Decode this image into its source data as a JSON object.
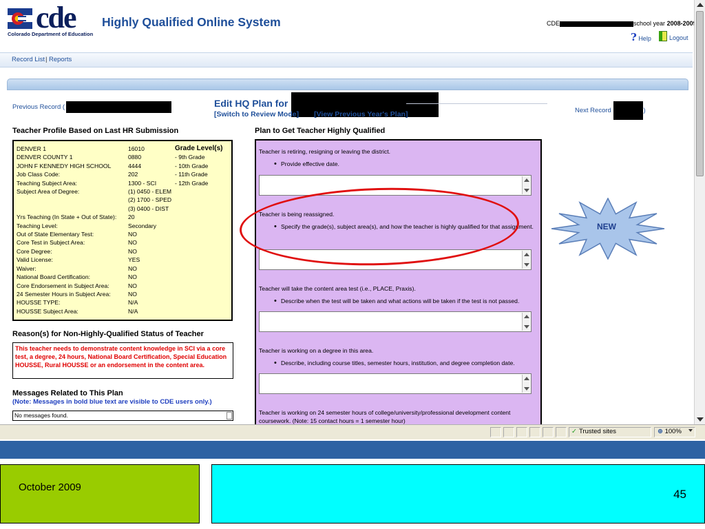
{
  "header": {
    "logo_text": "cde",
    "logo_subtitle": "Colorado Department of Education",
    "app_title": "Highly Qualified Online System",
    "school_year_prefix": "CDE",
    "school_year_suffix": "school year",
    "school_year_value": "2008-2009.",
    "help_label": "Help",
    "logout_label": "Logout"
  },
  "nav": {
    "record_list": "Record List",
    "separator": "|",
    "reports": "Reports"
  },
  "record_bar": {
    "previous_record": "Previous Record (",
    "edit_title": "Edit HQ Plan for",
    "switch_mode": "[Switch to Review Mode]",
    "view_previous": "[View Previous Year's Plan]",
    "next_record": "Next Record",
    "next_record_close": ")"
  },
  "profile": {
    "heading": "Teacher Profile Based on Last HR Submission",
    "grade_heading": "Grade Level(s)",
    "rows": [
      {
        "label": "DENVER 1",
        "value": "16010",
        "grade": ""
      },
      {
        "label": "DENVER COUNTY 1",
        "value": "0880",
        "grade": "- 9th Grade"
      },
      {
        "label": "JOHN F KENNEDY HIGH SCHOOL",
        "value": "4444",
        "grade": "- 10th Grade"
      },
      {
        "label": "Job Class Code:",
        "value": "202",
        "grade": "- 11th Grade"
      },
      {
        "label": "Teaching Subject Area:",
        "value": "1300 - SCI",
        "grade": "- 12th Grade"
      },
      {
        "label": "Subject Area of Degree:",
        "value": "(1) 0450 - ELEM",
        "grade": ""
      },
      {
        "label": "",
        "value": "(2) 1700 - SPED",
        "grade": ""
      },
      {
        "label": "",
        "value": "(3) 0400 - DIST",
        "grade": ""
      },
      {
        "label": "Yrs Teaching (In State + Out of State):",
        "value": "20",
        "grade": ""
      },
      {
        "label": "Teaching Level:",
        "value": "Secondary",
        "grade": ""
      },
      {
        "label": "Out of State Elementary Test:",
        "value": "NO",
        "grade": ""
      },
      {
        "label": "Core Test in Subject Area:",
        "value": "NO",
        "grade": ""
      },
      {
        "label": "Core Degree:",
        "value": "NO",
        "grade": ""
      },
      {
        "label": "Valid License:",
        "value": "YES",
        "grade": ""
      },
      {
        "label": "Waiver:",
        "value": "NO",
        "grade": ""
      },
      {
        "label": "National Board Certification:",
        "value": "NO",
        "grade": ""
      },
      {
        "label": "Core Endorsement in Subject Area:",
        "value": "NO",
        "grade": ""
      },
      {
        "label": "24 Semester Hours in Subject Area:",
        "value": "NO",
        "grade": ""
      },
      {
        "label": "HOUSSE TYPE:",
        "value": "N/A",
        "grade": ""
      },
      {
        "label": "HOUSSE Subject Area:",
        "value": "N/A",
        "grade": ""
      }
    ]
  },
  "reasons": {
    "heading": "Reason(s) for Non-Highly-Qualified Status of Teacher",
    "text": "This teacher needs to demonstrate content knowledge in SCI via a core test, a degree, 24 hours, National Board Certification, Special Education HOUSSE, Rural HOUSSE or an endorsement in the content area."
  },
  "messages": {
    "heading": "Messages Related to This Plan",
    "note": "(Note: Messages in bold blue text are visible to CDE users only.)",
    "empty_text": "No messages found."
  },
  "plan": {
    "heading": "Plan to Get Teacher Highly Qualified",
    "sections": [
      {
        "intro": "Teacher is retiring, resigning or leaving the district.",
        "bullet": "Provide effective date."
      },
      {
        "intro": "Teacher is being reassigned.",
        "bullet": "Specify the grade(s), subject area(s), and how the teacher is highly qualified for that assignment."
      },
      {
        "intro": "Teacher will take the content area test (i.e., PLACE, Praxis).",
        "bullet": "Describe when the test will be taken and what actions will be taken if the test is not passed."
      },
      {
        "intro": "Teacher is working on a degree in this area.",
        "bullet": "Describe, including course titles, semester hours, institution, and degree completion date."
      },
      {
        "intro": "Teacher is working on 24 semester hours of college/university/professional development content coursework. (Note: 15 contact hours = 1 semester hour)",
        "bullet": ""
      }
    ]
  },
  "annotation": {
    "new_label": "NEW",
    "ellipse_color": "#e01010",
    "star_fill": "#a9c5ea"
  },
  "status_bar": {
    "zone": "Trusted sites",
    "zoom": "100%"
  },
  "footer": {
    "date": "October 2009",
    "page_number": "45"
  },
  "colors": {
    "link_blue": "#1f4f9a",
    "profile_bg": "#ffffc6",
    "plan_bg": "#dbb6f2",
    "footer_band": "#2e62a3",
    "footer_green": "#99cc00",
    "footer_cyan": "#00ffff"
  },
  "icons": {
    "help": "help-question-icon",
    "logout": "logout-door-icon",
    "trusted": "checkmark-icon",
    "zoom": "zoom-icon"
  }
}
